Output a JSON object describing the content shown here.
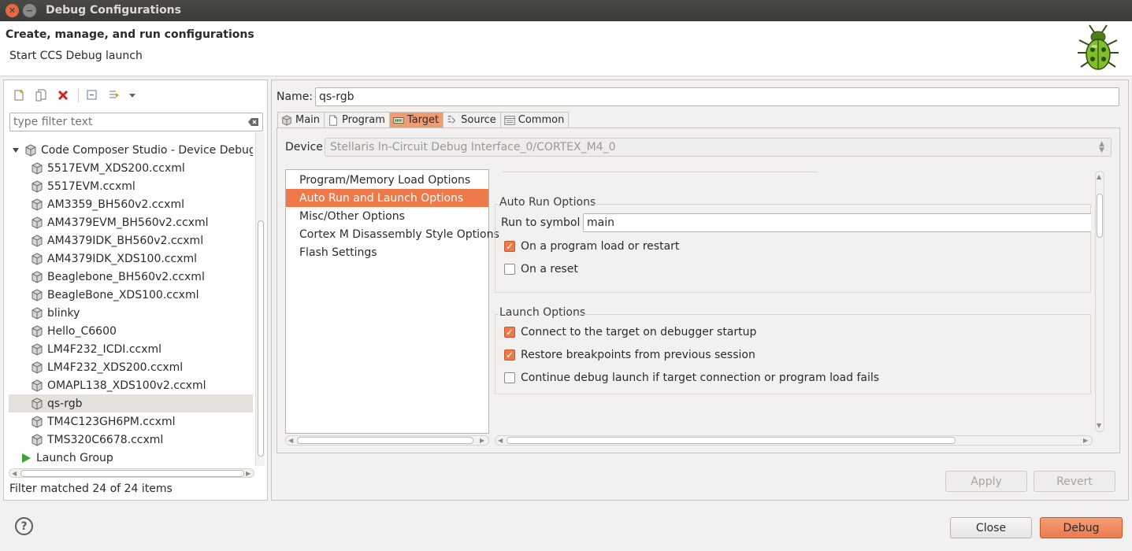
{
  "window": {
    "title": "Debug Configurations"
  },
  "header": {
    "title": "Create, manage, and run configurations",
    "subtitle": "Start CCS Debug launch"
  },
  "left": {
    "filter_placeholder": "type filter text",
    "tree": {
      "group_label": "Code Composer Studio - Device Debuggin",
      "items": [
        "5517EVM_XDS200.ccxml",
        "5517EVM.ccxml",
        "AM3359_BH560v2.ccxml",
        "AM4379EVM_BH560v2.ccxml",
        "AM4379IDK_BH560v2.ccxml",
        "AM4379IDK_XDS100.ccxml",
        "Beaglebone_BH560v2.ccxml",
        "BeagleBone_XDS100.ccxml",
        "blinky",
        "Hello_C6600",
        "LM4F232_ICDI.ccxml",
        "LM4F232_XDS200.ccxml",
        "OMAPL138_XDS100v2.ccxml",
        "qs-rgb",
        "TM4C123GH6PM.ccxml",
        "TMS320C6678.ccxml"
      ],
      "launch_group": "Launch Group"
    },
    "status": "Filter matched 24 of 24 items"
  },
  "right": {
    "name_label": "Name:",
    "name_value": "qs-rgb",
    "tabs": [
      "Main",
      "Program",
      "Target",
      "Source",
      "Common"
    ],
    "device_label": "Device",
    "device_value": "Stellaris In-Circuit Debug Interface_0/CORTEX_M4_0",
    "categories": [
      "Program/Memory Load Options",
      "Auto Run and Launch Options",
      "Misc/Other Options",
      "Cortex M Disassembly Style Options",
      "Flash Settings"
    ],
    "auto_run": {
      "title": "Auto Run Options",
      "run_to_symbol_label": "Run to symbol",
      "run_to_symbol_value": "main",
      "on_load_label": "On a program load or restart",
      "on_reset_label": "On a reset"
    },
    "launch": {
      "title": "Launch Options",
      "connect_label": "Connect to the target on debugger startup",
      "restore_label": "Restore breakpoints from previous session",
      "continue_label": "Continue debug launch if target connection or program load fails"
    }
  },
  "buttons": {
    "apply": "Apply",
    "revert": "Revert",
    "close": "Close",
    "debug": "Debug"
  },
  "colors": {
    "accent": "#f0794a",
    "titlebar": "#3c3b37"
  }
}
